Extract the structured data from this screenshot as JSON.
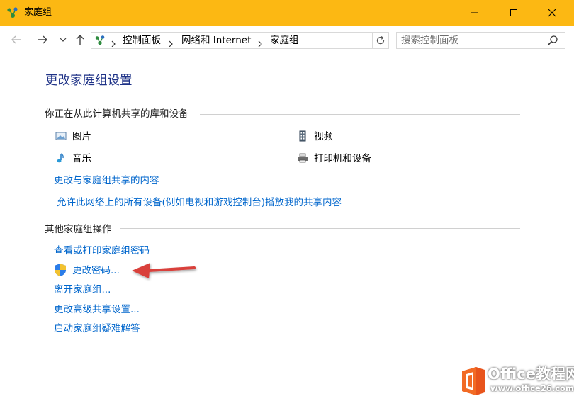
{
  "window": {
    "title": "家庭组",
    "title_bar_color": "#fcb813"
  },
  "navigation": {
    "back_icon": "arrow-left-icon",
    "forward_icon": "arrow-right-icon",
    "recent_icon": "chevron-down-icon",
    "up_icon": "arrow-up-icon"
  },
  "address": {
    "breadcrumbs": [
      "控制面板",
      "网络和 Internet",
      "家庭组"
    ]
  },
  "search": {
    "placeholder": "搜索控制面板"
  },
  "main": {
    "title": "更改家庭组设置",
    "shared_section": {
      "heading": "你正在从此计算机共享的库和设备",
      "items": [
        {
          "label": "图片",
          "icon": "pictures-icon"
        },
        {
          "label": "视频",
          "icon": "videos-icon"
        },
        {
          "label": "音乐",
          "icon": "music-icon"
        },
        {
          "label": "打印机和设备",
          "icon": "printer-icon"
        }
      ],
      "links": [
        "更改与家庭组共享的内容",
        "允许此网络上的所有设备(例如电视和游戏控制台)播放我的共享内容"
      ]
    },
    "other_section": {
      "heading": "其他家庭组操作",
      "links": [
        "查看或打印家庭组密码",
        "更改密码...",
        "离开家庭组...",
        "更改高级共享设置...",
        "启动家庭组疑难解答"
      ]
    }
  },
  "colors": {
    "link": "#0066cc",
    "title": "#1e3287",
    "annotation_arrow": "#d9403a"
  },
  "watermark": {
    "line1": "Office教程网",
    "line2": "www.office26.com"
  }
}
